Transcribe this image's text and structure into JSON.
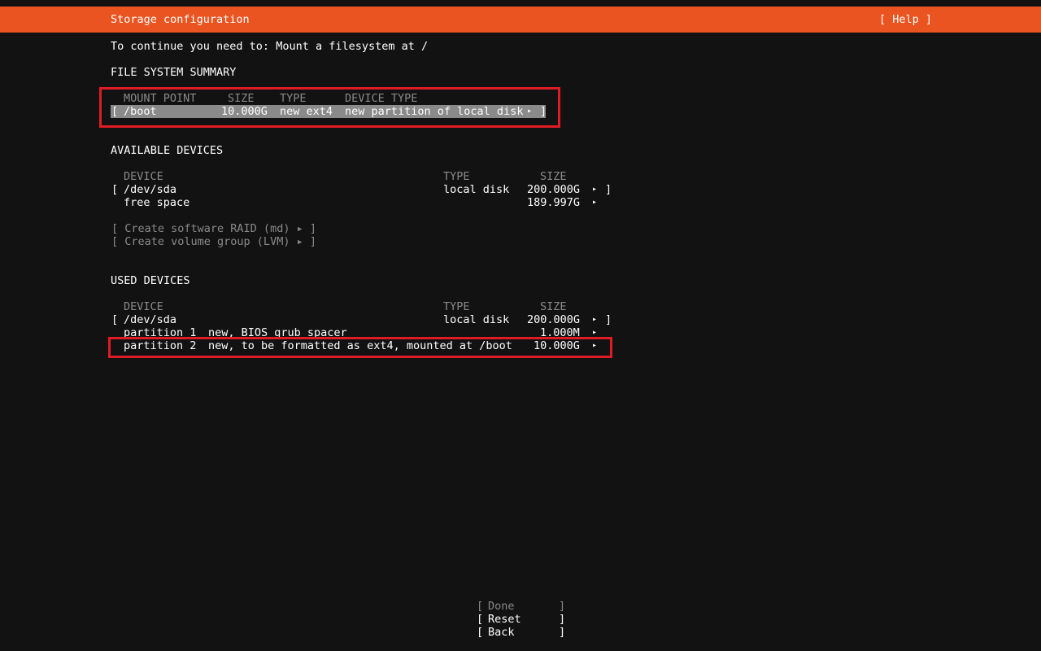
{
  "header": {
    "title": "Storage configuration",
    "help_label": "[ Help ]"
  },
  "message": "To continue you need to: Mount a filesystem at /",
  "fs_summary": {
    "heading": "FILE SYSTEM SUMMARY",
    "columns": [
      "MOUNT POINT",
      "SIZE",
      "TYPE",
      "DEVICE TYPE"
    ],
    "row": {
      "open": "[",
      "mount": "/boot",
      "size": "10.000G",
      "type": "new ext4",
      "device_type": "new partition of local disk",
      "arrow": "▸",
      "close": "]"
    }
  },
  "available": {
    "heading": "AVAILABLE DEVICES",
    "columns": [
      "DEVICE",
      "TYPE",
      "SIZE"
    ],
    "disk": {
      "open": "[",
      "name": "/dev/sda",
      "type": "local disk",
      "size": "200.000G",
      "arrow": "▸",
      "close": "]"
    },
    "free": {
      "name": "free space",
      "size": "189.997G",
      "arrow": "▸"
    },
    "raid_label": "[ Create software RAID (md) ▸ ]",
    "lvm_label": "[ Create volume group (LVM) ▸ ]"
  },
  "used": {
    "heading": "USED DEVICES",
    "columns": [
      "DEVICE",
      "TYPE",
      "SIZE"
    ],
    "disk": {
      "open": "[",
      "name": "/dev/sda",
      "type": "local disk",
      "size": "200.000G",
      "arrow": "▸",
      "close": "]"
    },
    "partitions": [
      {
        "name": "partition 1",
        "desc": "new, BIOS grub spacer",
        "size": "1.000M",
        "arrow": "▸"
      },
      {
        "name": "partition 2",
        "desc": "new, to be formatted as ext4, mounted at /boot",
        "size": "10.000G",
        "arrow": "▸"
      }
    ]
  },
  "buttons": {
    "done": {
      "open": "[",
      "label": "Done",
      "close": "]"
    },
    "reset": {
      "open": "[",
      "label": "Reset",
      "close": "]"
    },
    "back": {
      "open": "[",
      "label": "Back",
      "close": "]"
    }
  },
  "colors": {
    "title_bar": "#e95420",
    "background": "#121212",
    "highlight": "#8a8a8a",
    "annotation_box": "#e01b24"
  }
}
